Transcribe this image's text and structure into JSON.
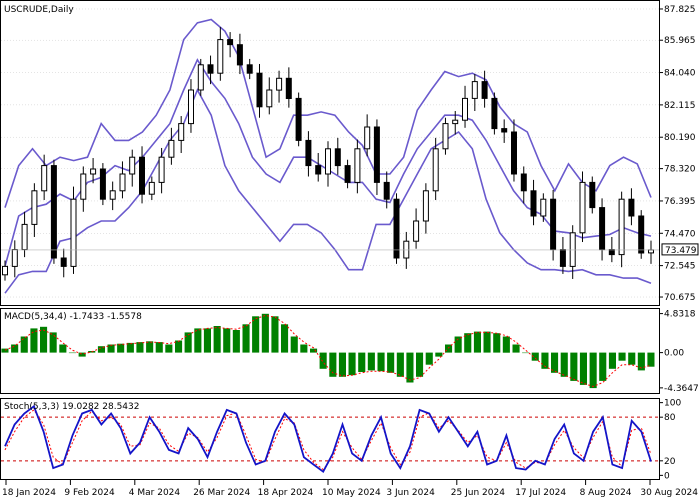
{
  "chart_data": {
    "type": "candlestick",
    "panels": [
      {
        "id": "price",
        "title": "USCRUDE,Daily",
        "y_ticks": [
          "87.825",
          "85.965",
          "84.040",
          "82.115",
          "80.190",
          "78.320",
          "76.395",
          "74.470",
          "72.545",
          "70.675"
        ],
        "y_tick_values": [
          87.825,
          85.965,
          84.04,
          82.115,
          80.19,
          78.32,
          76.395,
          74.47,
          72.545,
          70.675
        ],
        "ylim": [
          70.2,
          88.3
        ],
        "last_price": "73.479",
        "last_price_value": 73.479,
        "colors": {
          "candle": "#000000",
          "bollinger": "#6a5acd",
          "grid": "#c8c8c8"
        },
        "bollinger": {
          "upper": [
            76,
            78.5,
            79.5,
            78.5,
            79,
            78.8,
            79,
            81,
            80,
            80,
            80.5,
            81.5,
            83,
            86,
            87,
            87.2,
            86.5,
            85,
            82,
            79,
            79.5,
            81.5,
            81.5,
            81.7,
            81.5,
            80.5,
            79.7,
            78,
            78,
            79,
            81.8,
            83,
            84.1,
            83.8,
            84,
            83.6,
            82,
            81,
            80.5,
            78.5,
            77,
            78.6,
            77.5,
            77,
            78.5,
            79,
            78.6,
            76.6
          ],
          "middle": [
            72.5,
            75.5,
            76,
            76.2,
            76.8,
            76.4,
            77.5,
            77.8,
            78.5,
            78.2,
            79,
            80,
            81,
            83,
            84.8,
            83.5,
            82.5,
            81,
            79,
            78,
            77.5,
            79,
            79,
            78.5,
            78,
            77.5,
            77.5,
            76.5,
            76.3,
            78,
            79.5,
            80.5,
            81.5,
            81.5,
            81.2,
            80,
            78.5,
            77,
            76,
            75.6,
            74.6,
            74.5,
            74.2,
            74.3,
            74.4,
            74.8,
            74.5,
            74.3
          ],
          "lower": [
            70.9,
            72,
            72.2,
            72.2,
            74,
            74.2,
            74.8,
            75.2,
            75.2,
            76,
            77,
            78.5,
            80,
            81,
            83,
            81.5,
            78.5,
            77,
            76,
            75,
            74,
            75,
            75,
            74.5,
            73.5,
            72.3,
            72.3,
            75,
            75,
            76.5,
            78,
            79.5,
            80,
            80.5,
            79.5,
            76.5,
            74.5,
            73.5,
            72.7,
            72.3,
            72.3,
            72.2,
            72.3,
            72,
            72,
            71.8,
            71.8,
            71.5
          ]
        },
        "close": [
          72.5,
          73.5,
          75,
          77,
          78.5,
          73,
          72.5,
          76.5,
          78,
          78.3,
          76.5,
          77,
          78,
          79,
          76.8,
          77.5,
          79,
          80,
          81,
          83,
          84.5,
          84,
          86,
          85.7,
          84.5,
          84,
          82,
          83,
          83.7,
          82.5,
          80,
          78.5,
          78,
          79.5,
          78.5,
          77.5,
          79.5,
          80.8,
          77.5,
          76.5,
          73,
          74,
          75.2,
          77,
          79.5,
          81,
          81.2,
          82.5,
          83.5,
          82.5,
          80.7,
          80.5,
          78,
          77,
          75.5,
          76.5,
          73.5,
          72.5,
          74.5,
          77.5,
          76,
          73.5,
          73.2,
          76.5,
          75.5,
          73.3,
          73.48
        ]
      },
      {
        "id": "macd",
        "title": "MACD(5,34,4) -1.7433 -1.5578",
        "y_ticks": [
          "4.8318",
          "0.00",
          "-4.3647"
        ],
        "y_tick_values": [
          4.8318,
          0,
          -4.3647
        ],
        "ylim": [
          -5.0,
          5.4
        ],
        "colors": {
          "histogram": "#008000",
          "signal": "#ff0000"
        },
        "histogram": [
          0.5,
          1,
          2,
          3,
          3.2,
          2.5,
          1,
          0,
          -0.5,
          0.2,
          0.8,
          1,
          1.1,
          1.2,
          1.3,
          1.4,
          1.3,
          1,
          1.5,
          2.5,
          3,
          3,
          3.3,
          3,
          2.8,
          3.5,
          4.5,
          4.8,
          4.5,
          3.5,
          2,
          1,
          0.5,
          -2,
          -3,
          -3,
          -2.8,
          -2.4,
          -2.2,
          -2.3,
          -2.5,
          -3,
          -3.7,
          -3,
          -1.5,
          -0.5,
          1,
          2,
          2.4,
          2.6,
          2.6,
          2.4,
          2,
          1,
          0,
          -1,
          -2,
          -2.5,
          -3,
          -3.5,
          -4,
          -4.4,
          -3.5,
          -2,
          -1,
          -1.5,
          -2.2,
          -1.74
        ],
        "signal": [
          0.3,
          0.8,
          1.8,
          2.6,
          2.8,
          2.2,
          1.2,
          0.3,
          -0.2,
          0.1,
          0.6,
          0.9,
          1,
          1.1,
          1.2,
          1.3,
          1.25,
          1.1,
          1.4,
          2.2,
          2.8,
          3,
          3.1,
          3,
          2.9,
          3.3,
          4.2,
          4.6,
          4.4,
          3.6,
          2.3,
          1.3,
          0.6,
          -1.2,
          -2.5,
          -2.9,
          -2.8,
          -2.5,
          -2.3,
          -2.3,
          -2.4,
          -2.8,
          -3.4,
          -3.1,
          -1.9,
          -0.8,
          0.6,
          1.7,
          2.2,
          2.5,
          2.5,
          2.4,
          2.1,
          1.3,
          0.3,
          -0.7,
          -1.7,
          -2.3,
          -2.8,
          -3.3,
          -3.8,
          -4.2,
          -3.7,
          -2.5,
          -1.5,
          -1.5,
          -1.9,
          -1.56
        ]
      },
      {
        "id": "stoch",
        "title": "Stoch(5,3,3) 19.0282 28.5432",
        "y_ticks": [
          "100",
          "80",
          "20",
          "0"
        ],
        "y_tick_values": [
          100,
          80,
          20,
          0
        ],
        "ylim": [
          -5,
          105
        ],
        "levels": [
          80,
          20
        ],
        "colors": {
          "main": "#1414c8",
          "signal": "#ff0000",
          "levels": "#cc0000"
        },
        "main": [
          40,
          70,
          85,
          95,
          60,
          10,
          15,
          55,
          85,
          90,
          70,
          85,
          65,
          30,
          45,
          80,
          60,
          35,
          30,
          65,
          50,
          25,
          60,
          90,
          85,
          45,
          15,
          20,
          60,
          85,
          70,
          25,
          15,
          5,
          30,
          70,
          30,
          20,
          55,
          80,
          30,
          10,
          40,
          90,
          85,
          60,
          80,
          60,
          40,
          60,
          15,
          20,
          55,
          10,
          8,
          20,
          15,
          50,
          70,
          30,
          20,
          60,
          80,
          15,
          10,
          75,
          60,
          19
        ],
        "signal": [
          35,
          60,
          80,
          90,
          70,
          25,
          15,
          45,
          75,
          88,
          75,
          80,
          70,
          40,
          42,
          72,
          65,
          42,
          33,
          58,
          52,
          32,
          52,
          82,
          86,
          55,
          22,
          18,
          50,
          78,
          72,
          35,
          18,
          8,
          25,
          60,
          38,
          22,
          48,
          72,
          38,
          15,
          32,
          80,
          86,
          65,
          75,
          62,
          45,
          55,
          25,
          20,
          45,
          18,
          10,
          18,
          16,
          42,
          62,
          38,
          24,
          52,
          74,
          25,
          12,
          62,
          65,
          28.5
        ]
      }
    ],
    "x_tick_labels": [
      "18 Jan 2024",
      "9 Feb 2024",
      "4 Mar 2024",
      "26 Mar 2024",
      "18 Apr 2024",
      "10 May 2024",
      "3 Jun 2024",
      "25 Jun 2024",
      "17 Jul 2024",
      "8 Aug 2024",
      "30 Aug 2024"
    ]
  }
}
